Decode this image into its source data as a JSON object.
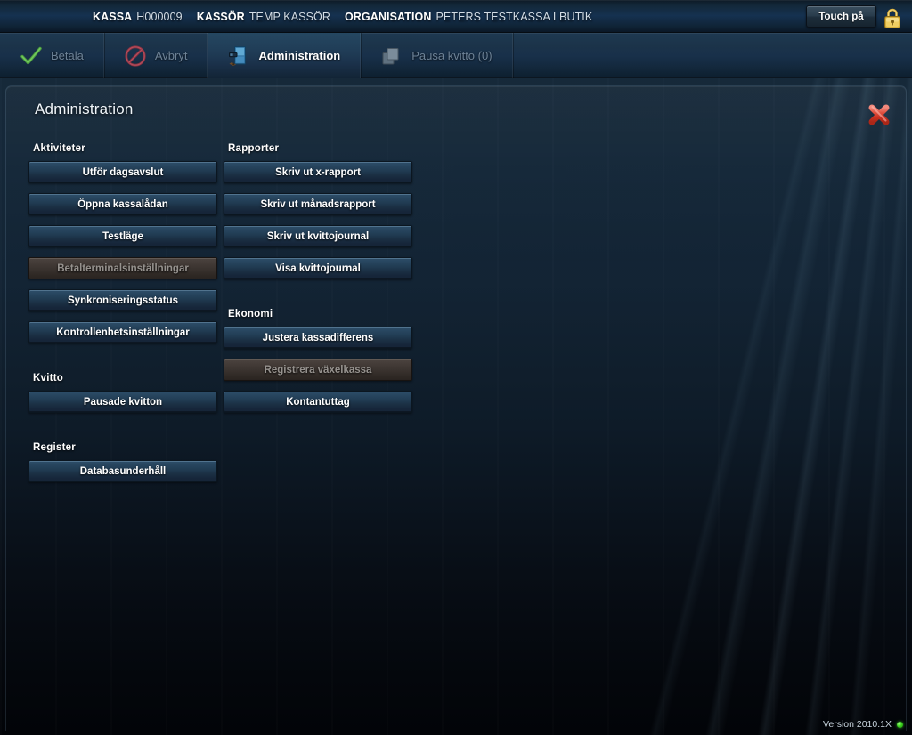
{
  "header": {
    "fields": [
      {
        "key": "KASSA",
        "value": "H000009"
      },
      {
        "key": "KASSÖR",
        "value": "TEMP KASSÖR"
      },
      {
        "key": "ORGANISATION",
        "value": "PETERS TESTKASSA I BUTIK"
      }
    ],
    "touch_button": "Touch på",
    "lock_icon": "lock-icon"
  },
  "toolbar": {
    "items": [
      {
        "label": "Betala",
        "icon": "check-icon",
        "state": "disabled"
      },
      {
        "label": "Avbryt",
        "icon": "cancel-icon",
        "state": "disabled"
      },
      {
        "label": "Administration",
        "icon": "cabinet-icon",
        "state": "active"
      },
      {
        "label": "Pausa kvitto (0)",
        "icon": "pause-receipt-icon",
        "state": "disabled"
      }
    ]
  },
  "panel": {
    "title": "Administration",
    "close_icon": "close-icon"
  },
  "left_column": [
    {
      "heading": "Aktiviteter",
      "buttons": [
        {
          "label": "Utför dagsavslut",
          "state": "enabled"
        },
        {
          "label": "Öppna kassalådan",
          "state": "enabled"
        },
        {
          "label": "Testläge",
          "state": "enabled"
        },
        {
          "label": "Betalterminalsinställningar",
          "state": "disabled"
        },
        {
          "label": "Synkroniseringsstatus",
          "state": "enabled"
        },
        {
          "label": "Kontrollenhetsinställningar",
          "state": "enabled"
        }
      ]
    },
    {
      "heading": "Kvitto",
      "buttons": [
        {
          "label": "Pausade kvitton",
          "state": "enabled"
        }
      ]
    },
    {
      "heading": "Register",
      "buttons": [
        {
          "label": "Databasunderhåll",
          "state": "enabled"
        }
      ]
    }
  ],
  "right_column": [
    {
      "heading": "Rapporter",
      "buttons": [
        {
          "label": "Skriv ut x-rapport",
          "state": "enabled"
        },
        {
          "label": "Skriv ut månadsrapport",
          "state": "enabled"
        },
        {
          "label": "Skriv ut kvittojournal",
          "state": "enabled"
        },
        {
          "label": "Visa kvittojournal",
          "state": "enabled"
        }
      ]
    },
    {
      "heading": "Ekonomi",
      "buttons": [
        {
          "label": "Justera kassadifferens",
          "state": "enabled"
        },
        {
          "label": "Registrera växelkassa",
          "state": "disabled"
        },
        {
          "label": "Kontantuttag",
          "state": "enabled"
        }
      ]
    }
  ],
  "footer": {
    "version": "Version 2010.1X",
    "status_dot_color": "#3fd420"
  },
  "colors": {
    "background": "#14283c",
    "accent_blue": "#27455e",
    "close_red": "#d93a2b",
    "disabled_button": "#39322e",
    "text_primary": "#ffffff",
    "text_muted": "#6d8296"
  }
}
